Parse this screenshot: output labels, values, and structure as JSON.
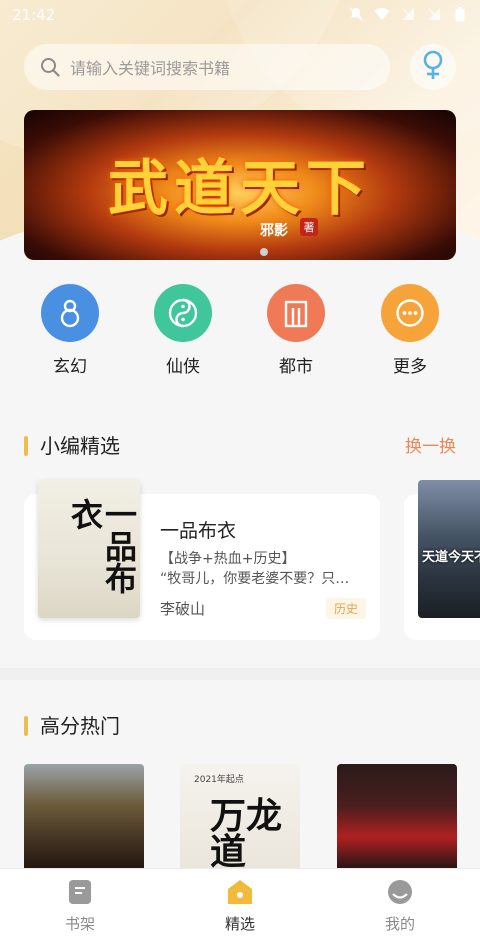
{
  "status_bar": {
    "time": "21:42"
  },
  "search": {
    "placeholder": "请输入关键词搜索书籍"
  },
  "banner": {
    "title": "武道天下",
    "subtitle": "邪影",
    "stamp": "著"
  },
  "categories": [
    {
      "label": "玄幻",
      "icon": "gourd-icon",
      "color": "#4a90e2"
    },
    {
      "label": "仙侠",
      "icon": "yin-yang-icon",
      "color": "#3fc69a"
    },
    {
      "label": "都市",
      "icon": "building-icon",
      "color": "#f07a55"
    },
    {
      "label": "更多",
      "icon": "more-icon",
      "color": "#f6a43a"
    }
  ],
  "editor_pick": {
    "title": "小编精选",
    "action": "换一换",
    "book": {
      "cover_title": "一品布衣",
      "title": "一品布衣",
      "tags": "【战争+热血+历史】",
      "description": "“牧哥儿，你要老婆不要？只…",
      "author": "李破山",
      "category": "历史"
    },
    "next_cover_text": "天道今天不"
  },
  "hot": {
    "title": "高分热门",
    "covers": [
      {
        "text": ""
      },
      {
        "text": "万龙道",
        "top_text": "2021年起点"
      },
      {
        "text": ""
      }
    ]
  },
  "tabs": [
    {
      "label": "书架",
      "icon": "bookshelf-icon",
      "active": false
    },
    {
      "label": "精选",
      "icon": "home-icon",
      "active": true
    },
    {
      "label": "我的",
      "icon": "profile-icon",
      "active": false
    }
  ],
  "colors": {
    "accent": "#f0bd4c",
    "action": "#e38a5e"
  }
}
